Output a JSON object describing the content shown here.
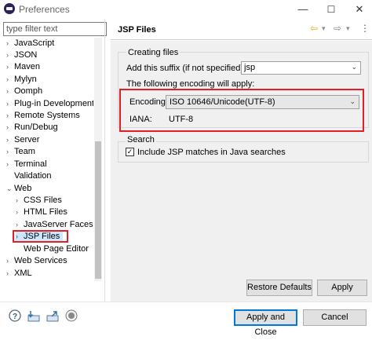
{
  "window": {
    "title": "Preferences",
    "minimize": "—",
    "maximize": "☐",
    "close": "✕"
  },
  "filter": {
    "placeholder": "type filter text"
  },
  "tree": {
    "items": [
      {
        "label": "JavaScript",
        "chevron": "›"
      },
      {
        "label": "JSON",
        "chevron": "›"
      },
      {
        "label": "Maven",
        "chevron": "›"
      },
      {
        "label": "Mylyn",
        "chevron": "›"
      },
      {
        "label": "Oomph",
        "chevron": "›"
      },
      {
        "label": "Plug-in Development",
        "chevron": "›"
      },
      {
        "label": "Remote Systems",
        "chevron": "›"
      },
      {
        "label": "Run/Debug",
        "chevron": "›"
      },
      {
        "label": "Server",
        "chevron": "›"
      },
      {
        "label": "Team",
        "chevron": "›"
      },
      {
        "label": "Terminal",
        "chevron": "›"
      },
      {
        "label": "Validation",
        "chevron": ""
      },
      {
        "label": "Web",
        "chevron": "⌄"
      },
      {
        "label": "CSS Files",
        "chevron": "›"
      },
      {
        "label": "HTML Files",
        "chevron": "›"
      },
      {
        "label": "JavaServer Faces To",
        "chevron": "›"
      },
      {
        "label": "JSP Files",
        "chevron": "›"
      },
      {
        "label": "Web Page Editor",
        "chevron": ""
      },
      {
        "label": "Web Services",
        "chevron": "›"
      },
      {
        "label": "XML",
        "chevron": "›"
      }
    ]
  },
  "page": {
    "title": "JSP Files",
    "nav_back": "⇦",
    "nav_back_menu": "▾",
    "nav_forward": "⇨",
    "nav_forward_menu": "▾",
    "nav_more": "⋮",
    "creating_files": {
      "group_label": "Creating files",
      "suffix_label": "Add this suffix (if not specified):",
      "suffix_value": "jsp",
      "encoding_note": "The following encoding will apply:",
      "encoding_label": "Encoding:",
      "encoding_value": "ISO 10646/Unicode(UTF-8)",
      "iana_label": "IANA:",
      "iana_value": "UTF-8"
    },
    "search": {
      "group_label": "Search",
      "include_label": "Include JSP matches in Java searches",
      "include_checked": true,
      "check_mark": "✓"
    },
    "restore_defaults": "Restore Defaults",
    "apply": "Apply"
  },
  "footer": {
    "apply_and_close": "Apply and Close",
    "cancel": "Cancel",
    "help_glyph": "?"
  },
  "colors": {
    "highlight": "#e21f26",
    "accent": "#0078d7"
  }
}
